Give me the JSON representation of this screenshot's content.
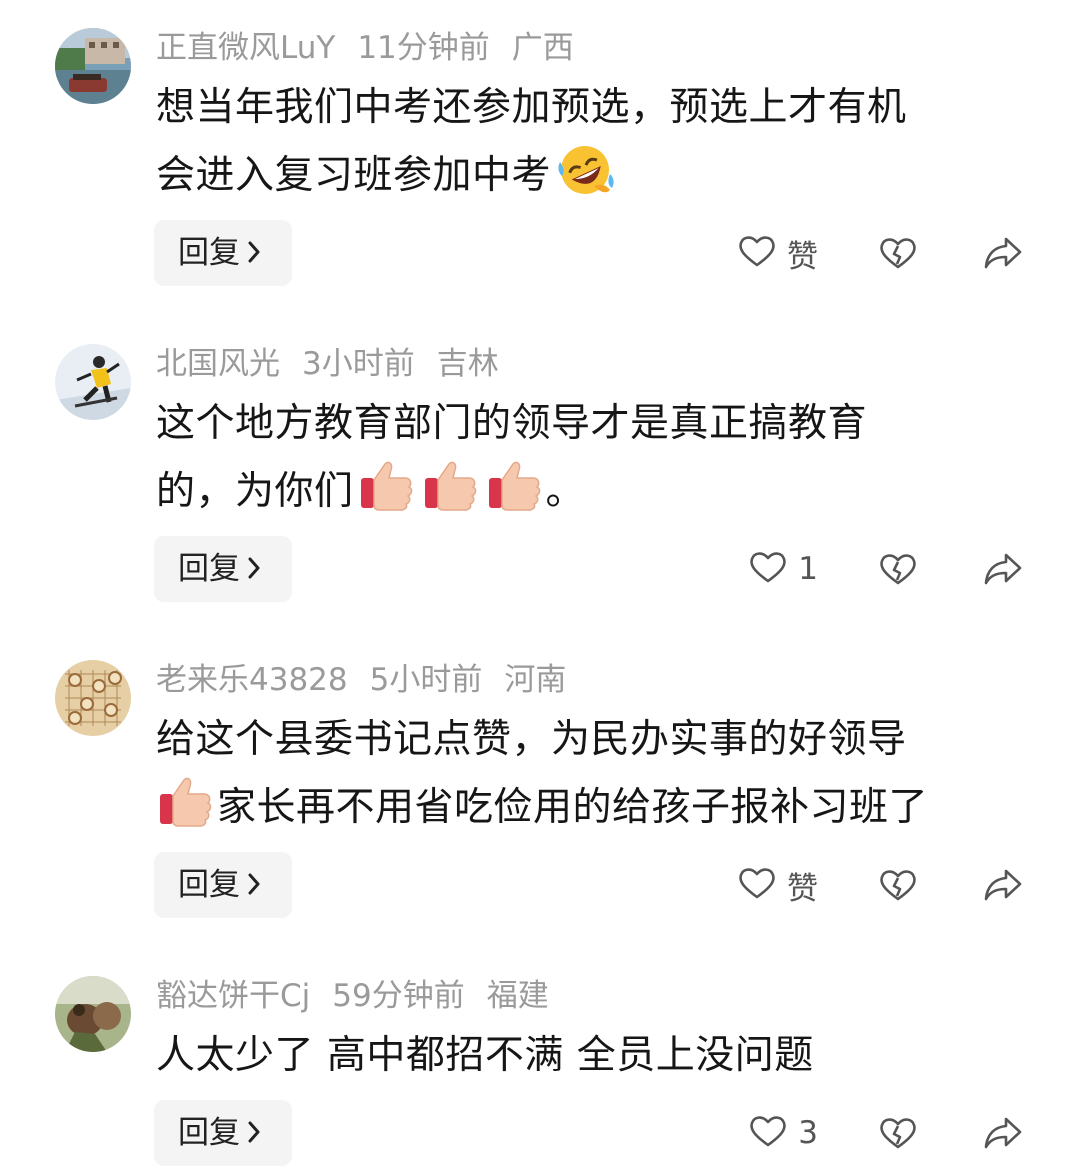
{
  "comments": [
    {
      "username": "正直微风LuY",
      "time": "11分钟前",
      "location": "广西",
      "text_lines": [
        "想当年我们中考还参加预选，预选上才有机",
        "会进入复习班参加中考"
      ],
      "reply_label": "回复",
      "likes": "赞",
      "emoji": "rolling-on-floor-laughing-emoji"
    },
    {
      "username": "北国风光",
      "time": "3小时前",
      "location": "吉林",
      "text_lines": [
        "这个地方教育部门的领导才是真正搞教育",
        "的，为你们"
      ],
      "text_suffix": "。",
      "reply_label": "回复",
      "likes": "1",
      "emoji": "thumbs-up-emoji"
    },
    {
      "username": "老来乐43828",
      "time": "5小时前",
      "location": "河南",
      "text_lines": [
        "给这个县委书记点赞，为民办实事的好领导",
        "家长再不用省吃俭用的给孩子报补习班了"
      ],
      "reply_label": "回复",
      "likes": "赞",
      "emoji": "thumbs-up-emoji"
    },
    {
      "username": "豁达饼干Cj",
      "time": "59分钟前",
      "location": "福建",
      "text_lines": [
        "人太少了 高中都招不满 全员上没问题"
      ],
      "reply_label": "回复",
      "likes": "3"
    }
  ],
  "icons": {
    "like": "heart-outline-icon",
    "dislike": "broken-heart-icon",
    "share": "share-arrow-icon",
    "reply_chevron": "chevron-right-icon"
  },
  "colors": {
    "meta_text": "#9a9a9a",
    "body_text": "#161616",
    "reply_bg": "#f4f4f4",
    "icon": "#555555"
  }
}
